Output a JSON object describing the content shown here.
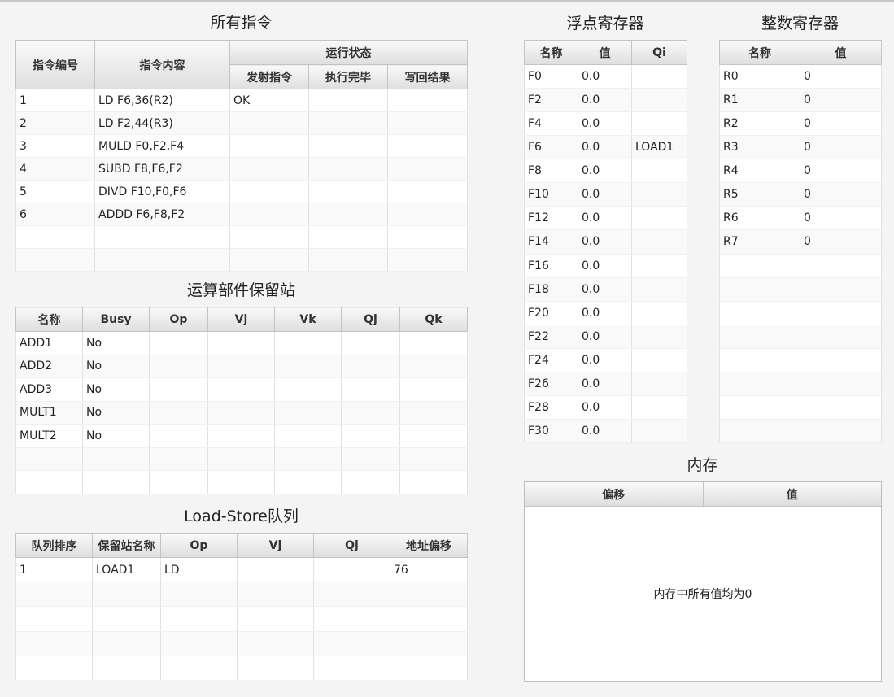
{
  "titles": {
    "instructions": "所有指令",
    "reservation": "运算部件保留站",
    "loadstore": "Load-Store队列",
    "fp_regs": "浮点寄存器",
    "int_regs": "整数寄存器",
    "memory": "内存"
  },
  "instructions": {
    "headers": {
      "id": "指令编号",
      "content": "指令内容",
      "status": "运行状态",
      "issue": "发射指令",
      "exec": "执行完毕",
      "write": "写回结果"
    },
    "rows": [
      [
        "1",
        "LD F6,36(R2)",
        "OK",
        "",
        ""
      ],
      [
        "2",
        "LD F2,44(R3)",
        "",
        "",
        ""
      ],
      [
        "3",
        "MULD F0,F2,F4",
        "",
        "",
        ""
      ],
      [
        "4",
        "SUBD F8,F6,F2",
        "",
        "",
        ""
      ],
      [
        "5",
        "DIVD F10,F0,F6",
        "",
        "",
        ""
      ],
      [
        "6",
        "ADDD F6,F8,F2",
        "",
        "",
        ""
      ]
    ]
  },
  "reservation": {
    "headers": [
      "名称",
      "Busy",
      "Op",
      "Vj",
      "Vk",
      "Qj",
      "Qk"
    ],
    "rows": [
      [
        "ADD1",
        "No",
        "",
        "",
        "",
        "",
        ""
      ],
      [
        "ADD2",
        "No",
        "",
        "",
        "",
        "",
        ""
      ],
      [
        "ADD3",
        "No",
        "",
        "",
        "",
        "",
        ""
      ],
      [
        "MULT1",
        "No",
        "",
        "",
        "",
        "",
        ""
      ],
      [
        "MULT2",
        "No",
        "",
        "",
        "",
        "",
        ""
      ]
    ]
  },
  "loadstore": {
    "headers": [
      "队列排序",
      "保留站名称",
      "Op",
      "Vj",
      "Qj",
      "地址偏移"
    ],
    "rows": [
      [
        "1",
        "LOAD1",
        "LD",
        "",
        "",
        "76"
      ]
    ]
  },
  "fp_regs": {
    "headers": [
      "名称",
      "值",
      "Qi"
    ],
    "rows": [
      [
        "F0",
        "0.0",
        ""
      ],
      [
        "F2",
        "0.0",
        ""
      ],
      [
        "F4",
        "0.0",
        ""
      ],
      [
        "F6",
        "0.0",
        "LOAD1"
      ],
      [
        "F8",
        "0.0",
        ""
      ],
      [
        "F10",
        "0.0",
        ""
      ],
      [
        "F12",
        "0.0",
        ""
      ],
      [
        "F14",
        "0.0",
        ""
      ],
      [
        "F16",
        "0.0",
        ""
      ],
      [
        "F18",
        "0.0",
        ""
      ],
      [
        "F20",
        "0.0",
        ""
      ],
      [
        "F22",
        "0.0",
        ""
      ],
      [
        "F24",
        "0.0",
        ""
      ],
      [
        "F26",
        "0.0",
        ""
      ],
      [
        "F28",
        "0.0",
        ""
      ],
      [
        "F30",
        "0.0",
        ""
      ]
    ]
  },
  "int_regs": {
    "headers": [
      "名称",
      "值"
    ],
    "rows": [
      [
        "R0",
        "0"
      ],
      [
        "R1",
        "0"
      ],
      [
        "R2",
        "0"
      ],
      [
        "R3",
        "0"
      ],
      [
        "R4",
        "0"
      ],
      [
        "R5",
        "0"
      ],
      [
        "R6",
        "0"
      ],
      [
        "R7",
        "0"
      ]
    ]
  },
  "memory": {
    "headers": [
      "偏移",
      "值"
    ],
    "empty_text": "内存中所有值均为0"
  }
}
